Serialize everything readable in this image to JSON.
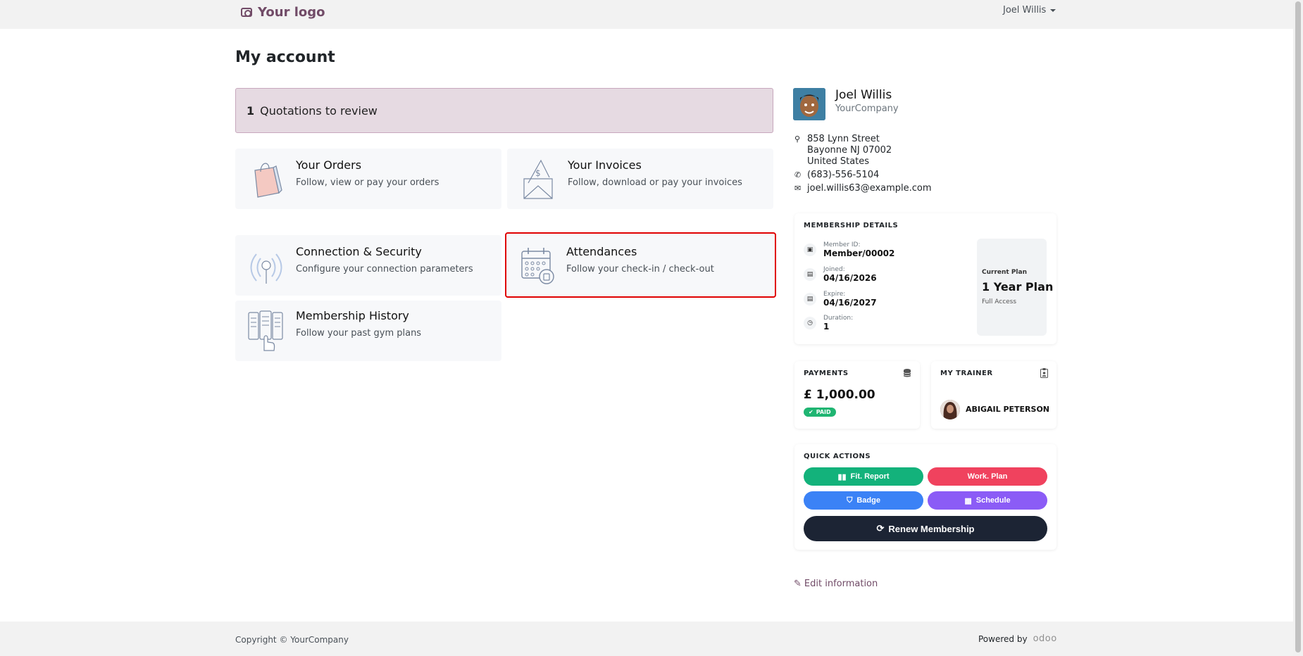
{
  "header": {
    "logo_text": "Your logo",
    "user_name": "Joel Willis"
  },
  "page": {
    "title": "My account"
  },
  "alert": {
    "count": "1",
    "text": "Quotations to review"
  },
  "cards": {
    "orders": {
      "title": "Your Orders",
      "subtitle": "Follow, view or pay your orders"
    },
    "invoices": {
      "title": "Your Invoices",
      "subtitle": "Follow, download or pay your invoices"
    },
    "security": {
      "title": "Connection & Security",
      "subtitle": "Configure your connection parameters"
    },
    "attendances": {
      "title": "Attendances",
      "subtitle": "Follow your check-in / check-out"
    },
    "membership_history": {
      "title": "Membership History",
      "subtitle": "Follow your past gym plans"
    }
  },
  "profile": {
    "name": "Joel Willis",
    "company": "YourCompany",
    "address_line1": "858 Lynn Street",
    "address_line2": "Bayonne NJ 07002",
    "address_line3": "United States",
    "phone": "(683)-556-5104",
    "email": "joel.willis63@example.com"
  },
  "membership": {
    "heading": "MEMBERSHIP DETAILS",
    "member_id_label": "Member ID:",
    "member_id": "Member/00002",
    "joined_label": "Joined:",
    "joined": "04/16/2026",
    "expire_label": "Expire:",
    "expire": "04/16/2027",
    "duration_label": "Duration:",
    "duration": "1",
    "plan_label": "Current Plan",
    "plan_name": "1 Year Plan",
    "plan_access": "Full Access"
  },
  "payments": {
    "heading": "PAYMENTS",
    "amount": "£ 1,000.00",
    "status": "PAID"
  },
  "trainer": {
    "heading": "MY TRAINER",
    "name": "ABIGAIL PETERSON"
  },
  "quick_actions": {
    "heading": "QUICK ACTIONS",
    "fit_report": "Fit. Report",
    "work_plan": "Work. Plan",
    "badge": "Badge",
    "schedule": "Schedule",
    "renew": "Renew Membership"
  },
  "edit_info": "Edit information",
  "footer": {
    "copyright": "Copyright © YourCompany",
    "powered_by": "Powered by",
    "brand": "odoo"
  },
  "colors": {
    "brand": "#714b67",
    "alert_bg": "#e6dae2",
    "green": "#13b27b",
    "red": "#f0425e",
    "blue": "#3b82f6",
    "purple": "#8b5cf6",
    "dark": "#1c2434",
    "highlight_border": "#e00000"
  },
  "icons": {
    "logo": "camera-icon",
    "orders": "shopping-bag-icon",
    "invoices": "invoice-envelope-icon",
    "security": "antenna-icon",
    "attendances": "calendar-icon",
    "membership_history": "document-hand-icon",
    "address": "map-marker-icon",
    "phone": "phone-icon",
    "email": "envelope-icon",
    "payments": "database-icon",
    "trainer": "id-badge-icon",
    "edit": "pencil-icon"
  }
}
